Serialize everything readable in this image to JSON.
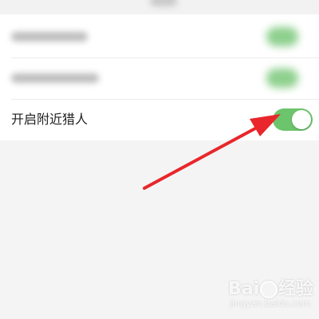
{
  "settings": {
    "nearby_hunters": {
      "label": "开启附近猎人",
      "enabled": true
    }
  },
  "colors": {
    "toggle_on": "#6cc56c",
    "arrow": "#e8262b",
    "background": "#f4f4f4",
    "card": "#ffffff"
  },
  "watermark": {
    "logo_left": "Bai",
    "logo_right": "经验",
    "sub": "jingyan.baidu.com"
  },
  "icons": {
    "toggle": "toggle-switch-icon",
    "annotation": "red-arrow-icon",
    "watermark_paw": "baidu-paw-icon"
  }
}
